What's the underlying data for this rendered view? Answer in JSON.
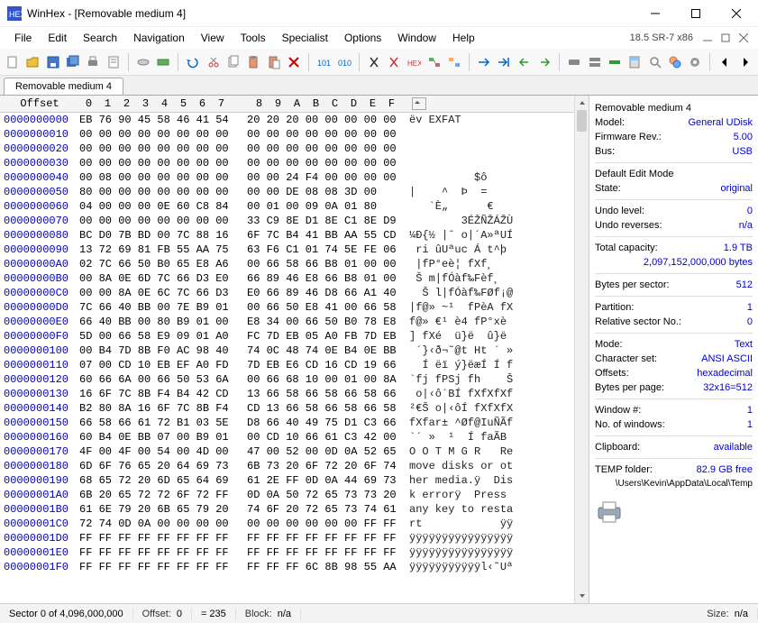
{
  "window": {
    "title": "WinHex - [Removable medium 4]",
    "version": "18.5 SR-7 x86"
  },
  "menu": [
    "File",
    "Edit",
    "Search",
    "Navigation",
    "View",
    "Tools",
    "Specialist",
    "Options",
    "Window",
    "Help"
  ],
  "tab": "Removable medium 4",
  "hex_header": [
    "0",
    "1",
    "2",
    "3",
    "4",
    "5",
    "6",
    "7",
    "8",
    "9",
    "A",
    "B",
    "C",
    "D",
    "E",
    "F"
  ],
  "offset_label": "Offset",
  "rows": [
    {
      "off": "0000000000",
      "a": "EB 76 90 45 58 46 41 54",
      "b": "20 20 20 00 00 00 00 00",
      "t": "ëv EXFAT"
    },
    {
      "off": "0000000010",
      "a": "00 00 00 00 00 00 00 00",
      "b": "00 00 00 00 00 00 00 00",
      "t": ""
    },
    {
      "off": "0000000020",
      "a": "00 00 00 00 00 00 00 00",
      "b": "00 00 00 00 00 00 00 00",
      "t": ""
    },
    {
      "off": "0000000030",
      "a": "00 00 00 00 00 00 00 00",
      "b": "00 00 00 00 00 00 00 00",
      "t": ""
    },
    {
      "off": "0000000040",
      "a": "00 08 00 00 00 00 00 00",
      "b": "00 00 24 F4 00 00 00 00",
      "t": "          $ô"
    },
    {
      "off": "0000000050",
      "a": "80 00 00 00 00 00 00 00",
      "b": "00 00 DE 08 08 3D 00",
      "t": "|    ^  Þ  ="
    },
    {
      "off": "0000000060",
      "a": "04 00 00 00 0E 60 C8 84",
      "b": "00 01 00 09 0A 01 80",
      "t": "   `È„      €"
    },
    {
      "off": "0000000070",
      "a": "00 00 00 00 00 00 00 00",
      "b": "33 C9 8E D1 8E C1 8E D9",
      "t": "        3ÉŽÑŽÁŽÙ"
    },
    {
      "off": "0000000080",
      "a": "BC D0 7B BD 00 7C 88 16",
      "b": "6F 7C B4 41 BB AA 55 CD",
      "t": "¼Ð{½ |ˆ o|´A»ªUÍ"
    },
    {
      "off": "0000000090",
      "a": "13 72 69 81 FB 55 AA 75",
      "b": "63 F6 C1 01 74 5E FE 06",
      "t": " ri ûUªuc Á t^þ"
    },
    {
      "off": "00000000A0",
      "a": "02 7C 66 50 B0 65 E8 A6",
      "b": "00 66 58 66 B8 01 00 00",
      "t": " |fP°eè¦ fXf¸"
    },
    {
      "off": "00000000B0",
      "a": "00 8A 0E 6D 7C 66 D3 E0",
      "b": "66 89 46 E8 66 B8 01 00",
      "t": " Š m|fÓàf‰Fèf¸"
    },
    {
      "off": "00000000C0",
      "a": "00 00 8A 0E 6C 7C 66 D3",
      "b": "E0 66 89 46 D8 66 A1 40",
      "t": "  Š l|fÓàf‰FØf¡@"
    },
    {
      "off": "00000000D0",
      "a": "7C 66 40 BB 00 7E B9 01",
      "b": "00 66 50 E8 41 00 66 58",
      "t": "|f@» ~¹  fPèA fX"
    },
    {
      "off": "00000000E0",
      "a": "66 40 BB 00 80 B9 01 00",
      "b": "E8 34 00 66 50 B0 78 E8",
      "t": "f@» €¹ è4 fP°xè"
    },
    {
      "off": "00000000F0",
      "a": "5D 00 66 58 E9 09 01 A0",
      "b": "FC 7D EB 05 A0 FB 7D EB",
      "t": "] fXé  ü}ë  û}ë"
    },
    {
      "off": "0000000100",
      "a": "00 B4 7D 8B F0 AC 98 40",
      "b": "74 0C 48 74 0E B4 0E BB",
      "t": " ´}‹ð¬˜@t Ht ´ »"
    },
    {
      "off": "0000000110",
      "a": "07 00 CD 10 EB EF A0 FD",
      "b": "7D EB E6 CD 16 CD 19 66",
      "t": "  Í ëï ý}ëæÍ Í f"
    },
    {
      "off": "0000000120",
      "a": "60 66 6A 00 66 50 53 6A",
      "b": "00 66 68 10 00 01 00 8A",
      "t": "`fj fPSj fh    Š"
    },
    {
      "off": "0000000130",
      "a": "16 6F 7C 8B F4 B4 42 CD",
      "b": "13 66 58 66 58 66 58 66",
      "t": " o|‹ô´BÍ fXfXfXf"
    },
    {
      "off": "0000000140",
      "a": "B2 80 8A 16 6F 7C 8B F4",
      "b": "CD 13 66 58 66 58 66 58",
      "t": "²€Š o|‹ôÍ fXfXfX"
    },
    {
      "off": "0000000150",
      "a": "66 58 66 61 72 B1 03 5E",
      "b": "D8 66 40 49 75 D1 C3 66",
      "t": "fXfar± ^Øf@IuÑÃf"
    },
    {
      "off": "0000000160",
      "a": "60 B4 0E BB 07 00 B9 01",
      "b": "00 CD 10 66 61 C3 42 00",
      "t": "`´ »  ¹  Í faÃB"
    },
    {
      "off": "0000000170",
      "a": "4F 00 4F 00 54 00 4D 00",
      "b": "47 00 52 00 0D 0A 52 65",
      "t": "O O T M G R   Re"
    },
    {
      "off": "0000000180",
      "a": "6D 6F 76 65 20 64 69 73",
      "b": "6B 73 20 6F 72 20 6F 74",
      "t": "move disks or ot"
    },
    {
      "off": "0000000190",
      "a": "68 65 72 20 6D 65 64 69",
      "b": "61 2E FF 0D 0A 44 69 73",
      "t": "her media.ÿ  Dis"
    },
    {
      "off": "00000001A0",
      "a": "6B 20 65 72 72 6F 72 FF",
      "b": "0D 0A 50 72 65 73 73 20",
      "t": "k errorÿ  Press "
    },
    {
      "off": "00000001B0",
      "a": "61 6E 79 20 6B 65 79 20",
      "b": "74 6F 20 72 65 73 74 61",
      "t": "any key to resta"
    },
    {
      "off": "00000001C0",
      "a": "72 74 0D 0A 00 00 00 00",
      "b": "00 00 00 00 00 00 FF FF",
      "t": "rt            ÿÿ"
    },
    {
      "off": "00000001D0",
      "a": "FF FF FF FF FF FF FF FF",
      "b": "FF FF FF FF FF FF FF FF",
      "t": "ÿÿÿÿÿÿÿÿÿÿÿÿÿÿÿÿ"
    },
    {
      "off": "00000001E0",
      "a": "FF FF FF FF FF FF FF FF",
      "b": "FF FF FF FF FF FF FF FF",
      "t": "ÿÿÿÿÿÿÿÿÿÿÿÿÿÿÿÿ"
    },
    {
      "off": "00000001F0",
      "a": "FF FF FF FF FF FF FF FF",
      "b": "FF FF FF 6C 8B 98 55 AA",
      "t": "ÿÿÿÿÿÿÿÿÿÿÿl‹˜Uª"
    }
  ],
  "side": {
    "title": "Removable medium 4",
    "model_l": "Model:",
    "model_v": "General UDisk",
    "fw_l": "Firmware Rev.:",
    "fw_v": "5.00",
    "bus_l": "Bus:",
    "bus_v": "USB",
    "dem_l": "Default Edit Mode",
    "state_l": "State:",
    "state_v": "original",
    "undo_l": "Undo level:",
    "undo_v": "0",
    "undor_l": "Undo reverses:",
    "undor_v": "n/a",
    "cap_l": "Total capacity:",
    "cap_v": "1.9 TB",
    "cap_bytes": "2,097,152,000,000 bytes",
    "bps_l": "Bytes per sector:",
    "bps_v": "512",
    "part_l": "Partition:",
    "part_v": "1",
    "rel_l": "Relative sector No.:",
    "rel_v": "0",
    "mode_l": "Mode:",
    "mode_v": "Text",
    "cs_l": "Character set:",
    "cs_v": "ANSI ASCII",
    "off_l": "Offsets:",
    "off_v": "hexadecimal",
    "bpp_l": "Bytes per page:",
    "bpp_v": "32x16=512",
    "win_l": "Window #:",
    "win_v": "1",
    "nwin_l": "No. of windows:",
    "nwin_v": "1",
    "clip_l": "Clipboard:",
    "clip_v": "available",
    "temp_l": "TEMP folder:",
    "temp_v": "82.9 GB free",
    "temp_path": "\\Users\\Kevin\\AppData\\Local\\Temp"
  },
  "status": {
    "sector": "Sector 0 of 4,096,000,000",
    "offset_l": "Offset:",
    "offset_v": "0",
    "eq": "= 235",
    "block_l": "Block:",
    "block_v": "n/a",
    "size_l": "Size:",
    "size_v": "n/a"
  }
}
